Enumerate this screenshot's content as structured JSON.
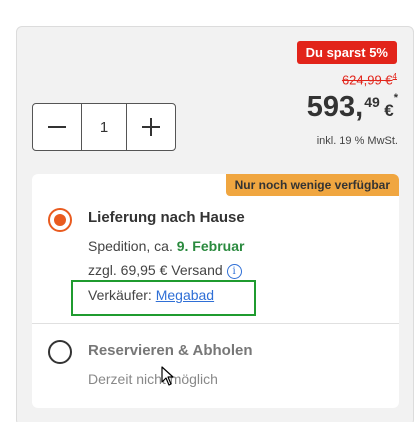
{
  "price_box": {
    "savings_badge": "Du sparst 5%",
    "old_price": "624,99 €",
    "old_price_sup": "4",
    "price_euros": "593,",
    "price_cents": "49",
    "price_currency": "€",
    "price_star": "*",
    "tax_note": "inkl. 19 % MwSt."
  },
  "quantity": {
    "value": "1",
    "minus_icon": "minus-icon",
    "plus_icon": "plus-icon"
  },
  "delivery": {
    "stock_badge": "Nur noch wenige verfügbar",
    "home_delivery": {
      "title": "Lieferung nach Hause",
      "shipping_prefix": "Spedition, ca.",
      "date": "9. Februar",
      "fee": "zzgl. 69,95 € Versand",
      "seller_label": "Verkäufer:",
      "seller_name": "Megabad",
      "selected": true
    },
    "pickup": {
      "title": "Reservieren & Abholen",
      "status": "Derzeit nicht möglich",
      "selected": false
    }
  },
  "colors": {
    "accent_red": "#e2241a",
    "radio_orange": "#e95b1f",
    "stock_orange": "#f0a640",
    "date_green": "#2a8a3e",
    "link_blue": "#2f6fd6",
    "highlight_green": "#1f9b2f"
  }
}
